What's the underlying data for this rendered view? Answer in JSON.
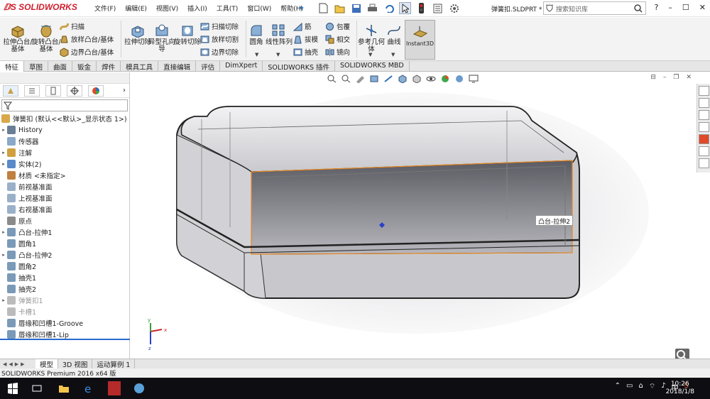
{
  "app": {
    "logo": "SOLIDWORKS",
    "document": "弹簧扣.SLDPRT *",
    "search_placeholder": "搜索知识库"
  },
  "menu": [
    "文件(F)",
    "编辑(E)",
    "视图(V)",
    "插入(I)",
    "工具(T)",
    "窗口(W)",
    "帮助(H)"
  ],
  "commands": {
    "extrude_boss": "拉伸凸台/基体",
    "revolve_boss": "旋转凸台/基体",
    "sweep": "扫描",
    "loft": "放样凸台/基体",
    "boundary_boss": "边界凸台/基体",
    "extrude_cut": "拉伸切除",
    "hole_wizard": "异型孔向导",
    "revolve_cut": "旋转切除",
    "swept_cut": "扫描切除",
    "lofted_cut": "放样切割",
    "boundary_cut": "边界切除",
    "fillet": "圆角",
    "linear_pattern": "线性阵列",
    "rib": "筋",
    "draft": "拔模",
    "shell": "抽壳",
    "wrap": "包覆",
    "intersect": "相交",
    "mirror": "镜向",
    "ref_geometry": "参考几何体",
    "curves": "曲线",
    "instant3d": "Instant3D"
  },
  "tabs": [
    "特征",
    "草图",
    "曲面",
    "钣金",
    "焊件",
    "模具工具",
    "直接编辑",
    "评估",
    "DimXpert",
    "SOLIDWORKS 插件",
    "SOLIDWORKS MBD"
  ],
  "tree": {
    "root": "弹簧扣  (默认<<默认>_显示状态 1>)",
    "items": [
      {
        "label": "History",
        "arrow": true
      },
      {
        "label": "传感器",
        "arrow": false
      },
      {
        "label": "注解",
        "arrow": true
      },
      {
        "label": "实体(2)",
        "arrow": true
      },
      {
        "label": "材质 <未指定>",
        "arrow": false
      },
      {
        "label": "前视基准面",
        "arrow": false
      },
      {
        "label": "上视基准面",
        "arrow": false
      },
      {
        "label": "右视基准面",
        "arrow": false
      },
      {
        "label": "原点",
        "arrow": false
      },
      {
        "label": "凸台-拉伸1",
        "arrow": true
      },
      {
        "label": "圆角1",
        "arrow": false
      },
      {
        "label": "凸台-拉伸2",
        "arrow": true
      },
      {
        "label": "圆角2",
        "arrow": false
      },
      {
        "label": "抽壳1",
        "arrow": false
      },
      {
        "label": "抽壳2",
        "arrow": false
      },
      {
        "label": "弹簧扣1",
        "arrow": true,
        "dim": true
      },
      {
        "label": "卡槽1",
        "arrow": false,
        "dim": true
      },
      {
        "label": "唇缘和凹槽1-Groove",
        "arrow": false
      },
      {
        "label": "唇缘和凹槽1-Lip",
        "arrow": false
      }
    ]
  },
  "bottom_tabs": [
    "模型",
    "3D 视图",
    "运动算例 1"
  ],
  "status": "SOLIDWORKS Premium 2016 x64 版",
  "tooltip": "凸台-拉伸2",
  "triad": {
    "x": "x",
    "y": "y",
    "z": "z"
  },
  "clock": {
    "time": "10:26",
    "date": "2018/1/8"
  },
  "ime": "中",
  "colors": {
    "accent": "#2a6acd",
    "highlight_edge": "#e8871e",
    "logo": "#d0202e"
  }
}
